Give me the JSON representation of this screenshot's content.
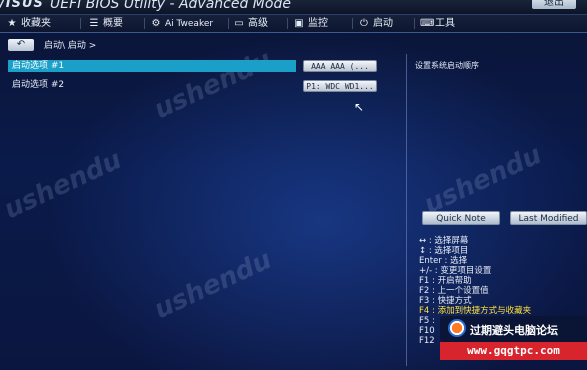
{
  "header": {
    "brand": "/ISUS",
    "title": "UEFI BIOS Utility - Advanced Mode",
    "exit_label": "退出"
  },
  "menu": {
    "items": [
      {
        "icon": "star-icon",
        "label": "收藏夹"
      },
      {
        "icon": "list-icon",
        "label": "概要"
      },
      {
        "icon": "tweaker-icon",
        "label": "Ai Tweaker"
      },
      {
        "icon": "advanced-icon",
        "label": "高级"
      },
      {
        "icon": "monitor-icon",
        "label": "监控"
      },
      {
        "icon": "power-icon",
        "label": "启动"
      },
      {
        "icon": "tool-icon",
        "label": "工具"
      }
    ]
  },
  "nav": {
    "back_symbol": "↶",
    "breadcrumb": "启动\\ 启动 >"
  },
  "boot_options": [
    {
      "label": "启动选项 #1",
      "value": "AAA AAA (...",
      "selected": true
    },
    {
      "label": "启动选项 #2",
      "value": "P1: WDC WD1...",
      "selected": false
    }
  ],
  "right_panel": {
    "title": "设置系统启动顺序",
    "quick_note_label": "Quick Note",
    "last_modified_label": "Last Modified",
    "help": [
      "↔ : 选择屏幕",
      "↕ : 选择项目",
      "Enter : 选择",
      "+/- : 变更项目设置",
      "F1 : 开启帮助",
      "F2 : 上一个设置值",
      "F3 : 快捷方式",
      "F4 : 添加到快捷方式与收藏夹",
      "F5 :",
      "F10",
      "F12"
    ]
  },
  "watermark": {
    "text": "ushendu"
  },
  "forum": {
    "name": "过期避头电脑论坛",
    "url": "www.gqgtpc.com"
  },
  "colors": {
    "selected_row": "#1aa0c8",
    "highlight_text": "#ffe23a",
    "forum_red": "#d8242c"
  }
}
